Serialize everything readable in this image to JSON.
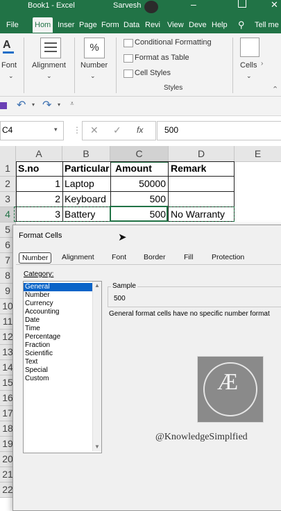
{
  "app": {
    "title": "Book1 - Excel",
    "user": "Sarvesh"
  },
  "ribbon_tabs": [
    "File",
    "Hom",
    "Inser",
    "Page",
    "Form",
    "Data",
    "Revi",
    "View",
    "Deve",
    "Help",
    "Tell me"
  ],
  "ribbon": {
    "font_label": "Font",
    "alignment_label": "Alignment",
    "number_label": "Number",
    "number_icon": "%",
    "conditional_formatting": "Conditional Formatting",
    "format_as_table": "Format as Table",
    "cell_styles": "Cell Styles",
    "styles_group": "Styles",
    "cells_label": "Cells"
  },
  "formula_bar": {
    "name_box": "C4",
    "fx": "fx",
    "value": "500"
  },
  "sheet": {
    "columns": [
      "A",
      "B",
      "C",
      "D",
      "E"
    ],
    "rows": [
      "1",
      "2",
      "3",
      "4",
      "5",
      "6",
      "7",
      "8",
      "9",
      "10",
      "11",
      "12",
      "13",
      "14",
      "15",
      "16",
      "17",
      "18",
      "19",
      "20",
      "21",
      "22"
    ],
    "headers": {
      "a": "S.no",
      "b": "Particular",
      "c": "Amount",
      "d": "Remark"
    },
    "data": [
      {
        "a": "1",
        "b": "Laptop",
        "c": "50000",
        "d": ""
      },
      {
        "a": "2",
        "b": "Keyboard",
        "c": "500",
        "d": ""
      },
      {
        "a": "3",
        "b": "Battery",
        "c": "500",
        "d": "No Warranty"
      }
    ]
  },
  "dialog": {
    "title": "Format Cells",
    "tabs": [
      "Number",
      "Alignment",
      "Font",
      "Border",
      "Fill",
      "Protection"
    ],
    "category_label": "Category:",
    "categories": [
      "General",
      "Number",
      "Currency",
      "Accounting",
      "Date",
      "Time",
      "Percentage",
      "Fraction",
      "Scientific",
      "Text",
      "Special",
      "Custom"
    ],
    "sample_label": "Sample",
    "sample_value": "500",
    "description": "General format cells have no specific number format"
  },
  "watermark": "@KnowledgeSimplfied",
  "colors": {
    "excel_green": "#217346",
    "selection_blue": "#0a64c8"
  }
}
